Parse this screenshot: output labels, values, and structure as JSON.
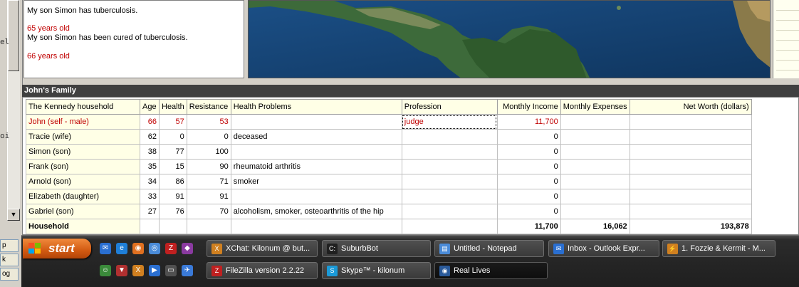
{
  "left_strip": {
    "fragments": [
      "el",
      "oi"
    ],
    "quick_labels": [
      "p",
      "k",
      "og"
    ]
  },
  "messages": [
    {
      "text": "My son Simon has tuberculosis.",
      "red": false
    },
    {
      "text": "65 years old",
      "red": true
    },
    {
      "text": "My son Simon has been cured of tuberculosis.",
      "red": false
    },
    {
      "text": "66 years old",
      "red": true
    }
  ],
  "family": {
    "title": "John's Family",
    "columns": [
      "The Kennedy household",
      "Age",
      "Health",
      "Resistance",
      "Health Problems",
      "Profession",
      "Monthly Income",
      "Monthly Expenses",
      "Net Worth (dollars)"
    ],
    "rows": [
      {
        "name": "John (self - male)",
        "age": "66",
        "health": "57",
        "resistance": "53",
        "problems": "",
        "profession": "judge",
        "income": "11,700",
        "expenses": "",
        "networth": ""
      },
      {
        "name": "Tracie (wife)",
        "age": "62",
        "health": "0",
        "resistance": "0",
        "problems": "deceased",
        "profession": "",
        "income": "0",
        "expenses": "",
        "networth": ""
      },
      {
        "name": "Simon (son)",
        "age": "38",
        "health": "77",
        "resistance": "100",
        "problems": "",
        "profession": "",
        "income": "0",
        "expenses": "",
        "networth": ""
      },
      {
        "name": "Frank (son)",
        "age": "35",
        "health": "15",
        "resistance": "90",
        "problems": "rheumatoid arthritis",
        "profession": "",
        "income": "0",
        "expenses": "",
        "networth": ""
      },
      {
        "name": "Arnold (son)",
        "age": "34",
        "health": "86",
        "resistance": "71",
        "problems": "smoker",
        "profession": "",
        "income": "0",
        "expenses": "",
        "networth": ""
      },
      {
        "name": "Elizabeth (daughter)",
        "age": "33",
        "health": "91",
        "resistance": "91",
        "problems": "",
        "profession": "",
        "income": "0",
        "expenses": "",
        "networth": ""
      },
      {
        "name": "Gabriel (son)",
        "age": "27",
        "health": "76",
        "resistance": "70",
        "problems": "alcoholism, smoker, osteoarthritis of the hip",
        "profession": "",
        "income": "0",
        "expenses": "",
        "networth": ""
      }
    ],
    "total": {
      "name": "Household",
      "income": "11,700",
      "expenses": "16,062",
      "networth": "193,878"
    }
  },
  "taskbar": {
    "start_label": "start",
    "quick_launch_row1": [
      {
        "name": "outlook-icon",
        "color": "#2a6fd1",
        "glyph": "✉"
      },
      {
        "name": "ie-icon",
        "color": "#1f7fd8",
        "glyph": "e"
      },
      {
        "name": "firefox-icon",
        "color": "#e07020",
        "glyph": "◉"
      },
      {
        "name": "globe-icon",
        "color": "#4a8bd8",
        "glyph": "◎"
      },
      {
        "name": "filezilla-icon",
        "color": "#c02020",
        "glyph": "Z"
      },
      {
        "name": "ghost-icon",
        "color": "#8a3aa0",
        "glyph": "◆"
      }
    ],
    "quick_launch_row2": [
      {
        "name": "users-icon",
        "color": "#3a8a3a",
        "glyph": "☺"
      },
      {
        "name": "triangle-icon",
        "color": "#b03030",
        "glyph": "▼"
      },
      {
        "name": "xchat-icon",
        "color": "#d08020",
        "glyph": "X"
      },
      {
        "name": "media-icon",
        "color": "#2a6fd1",
        "glyph": "▶"
      },
      {
        "name": "terminal-icon",
        "color": "#505050",
        "glyph": "▭"
      },
      {
        "name": "plane-icon",
        "color": "#3a7ad8",
        "glyph": "✈"
      }
    ],
    "tasks": [
      {
        "label": "XChat: Kilonum @ but...",
        "icon": "xchat-icon",
        "color": "#d08020",
        "glyph": "X",
        "active": false
      },
      {
        "label": "SuburbBot",
        "icon": "cmd-icon",
        "color": "#202020",
        "glyph": "C:",
        "active": false
      },
      {
        "label": "Untitled - Notepad",
        "icon": "notepad-icon",
        "color": "#4a8bd8",
        "glyph": "▤",
        "active": false
      },
      {
        "label": "Inbox - Outlook Expr...",
        "icon": "outlook-icon",
        "color": "#2a6fd1",
        "glyph": "✉",
        "active": false
      },
      {
        "label": "1. Fozzie & Kermit - M...",
        "icon": "winamp-icon",
        "color": "#d08020",
        "glyph": "⚡",
        "active": false
      },
      {
        "label": "FileZilla version 2.2.22",
        "icon": "filezilla-icon",
        "color": "#c02020",
        "glyph": "Z",
        "active": false
      },
      {
        "label": "Skype™ - kilonum",
        "icon": "skype-icon",
        "color": "#1a9ad8",
        "glyph": "S",
        "active": false
      },
      {
        "label": "Real Lives",
        "icon": "globe-icon",
        "color": "#2a5a9a",
        "glyph": "◉",
        "active": true
      }
    ]
  }
}
